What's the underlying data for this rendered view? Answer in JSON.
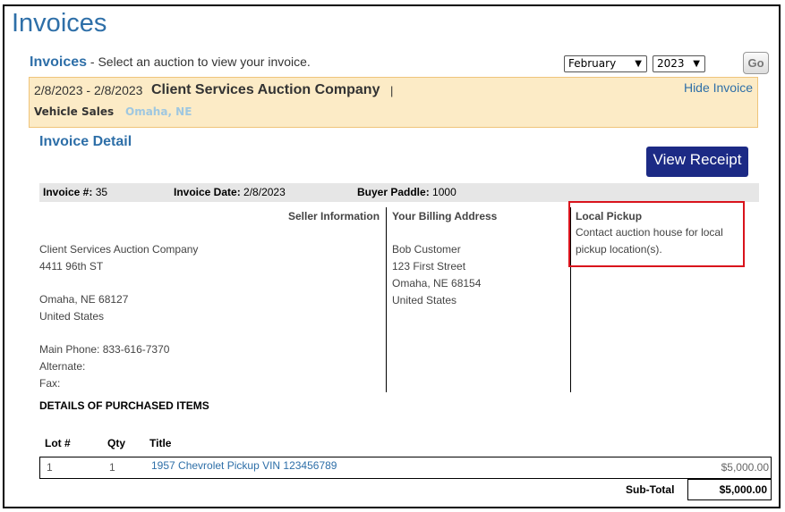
{
  "page": {
    "title": "Invoices"
  },
  "selector": {
    "label": "Invoices",
    "instruction": " - Select an auction to view your invoice.",
    "month": "February",
    "year": "2023",
    "go_label": "Go"
  },
  "auction": {
    "dates": "2/8/2023 - 2/8/2023",
    "name": "Client Services Auction Company",
    "separator": "|",
    "hide_label": "Hide Invoice",
    "category": "Vehicle Sales",
    "location": "Omaha, NE"
  },
  "invoice": {
    "detail_title": "Invoice Detail",
    "view_receipt_label": "View Receipt",
    "number_label": "Invoice #:",
    "number": "35",
    "date_label": "Invoice Date:",
    "date": "2/8/2023",
    "paddle_label": "Buyer Paddle:",
    "paddle": "1000"
  },
  "seller": {
    "header": "Seller Information",
    "name": "Client Services Auction Company",
    "street": "4411 96th ST",
    "city": "Omaha, NE  68127",
    "country": "United States",
    "main_phone": "Main Phone: 833-616-7370",
    "alternate": "Alternate:",
    "fax": "Fax:"
  },
  "billing": {
    "header": "Your Billing Address",
    "name": "Bob Customer",
    "street": "123 First Street",
    "city": "Omaha, NE  68154",
    "country": "United States"
  },
  "pickup": {
    "header": "Local Pickup",
    "line1": "Contact auction house for local",
    "line2": "pickup location(s)."
  },
  "items": {
    "section_title": "DETAILS OF PURCHASED ITEMS",
    "columns": {
      "lot": "Lot #",
      "qty": "Qty",
      "title": "Title"
    },
    "rows": [
      {
        "lot": "1",
        "qty": "1",
        "title": "1957 Chevrolet Pickup VIN 123456789",
        "amount": "$5,000.00"
      }
    ],
    "subtotal_label": "Sub-Total",
    "subtotal": "$5,000.00"
  },
  "colors": {
    "accent": "#2e6fa8",
    "receipt_button": "#1c2a85",
    "highlight_box": "#d9131c",
    "auction_bar": "#fcebc6"
  }
}
